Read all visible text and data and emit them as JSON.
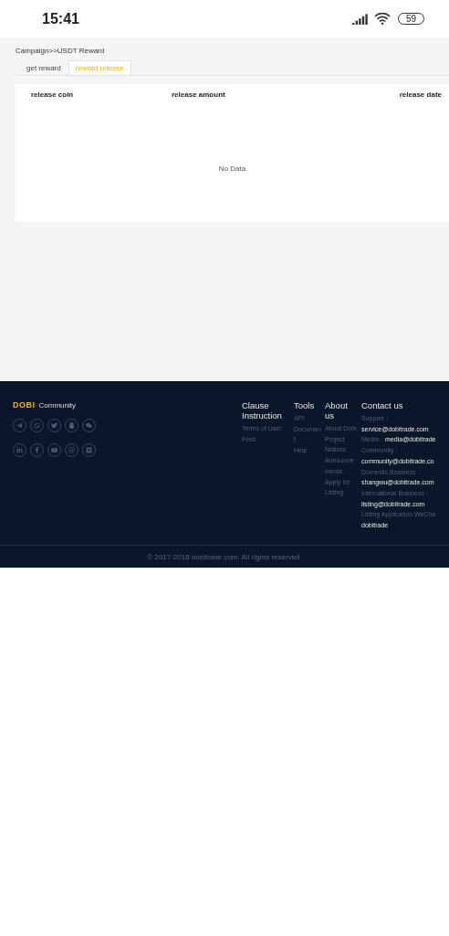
{
  "status_bar": {
    "time": "15:41",
    "battery": "59"
  },
  "breadcrumb": "Campaign>>USDT Reward",
  "tabs": [
    {
      "label": "get reward",
      "selected": false
    },
    {
      "label": "reward release",
      "selected": true
    }
  ],
  "table": {
    "columns": [
      "release coin",
      "release amount",
      "release date"
    ],
    "empty_text": "No Data"
  },
  "footer": {
    "logo": "DOBI",
    "logo_caption": "Community",
    "columns": [
      {
        "title": "Clause Instruction",
        "links": [
          "Terms of User",
          "Fees"
        ]
      },
      {
        "title": "Tools",
        "links": [
          "API Document",
          "Help"
        ]
      },
      {
        "title": "About us",
        "links": [
          "About Dobi Project",
          "Notices",
          "Announcements",
          "Apply for Listing"
        ]
      }
    ],
    "contact": {
      "title": "Contact us",
      "items": [
        {
          "label": "Support：",
          "value": "service@dobitrade.com",
          "kind": "stacked"
        },
        {
          "label": "Media：",
          "value": "media@dobitrade",
          "kind": "inline"
        },
        {
          "label": "Community：",
          "value": "community@dobitrade.co",
          "kind": "stacked"
        },
        {
          "label": "Domestic Business：",
          "value": "shangwu@dobitrade.com",
          "kind": "stacked"
        },
        {
          "label": "International Business：",
          "value": "listing@dobitrade.com",
          "kind": "stacked"
        },
        {
          "label": "Listing Application WeCha",
          "value": "dobitrade",
          "kind": "stacked"
        }
      ]
    },
    "copyright": "© 2017-2018 dobitrade.com. All rights reserved."
  }
}
